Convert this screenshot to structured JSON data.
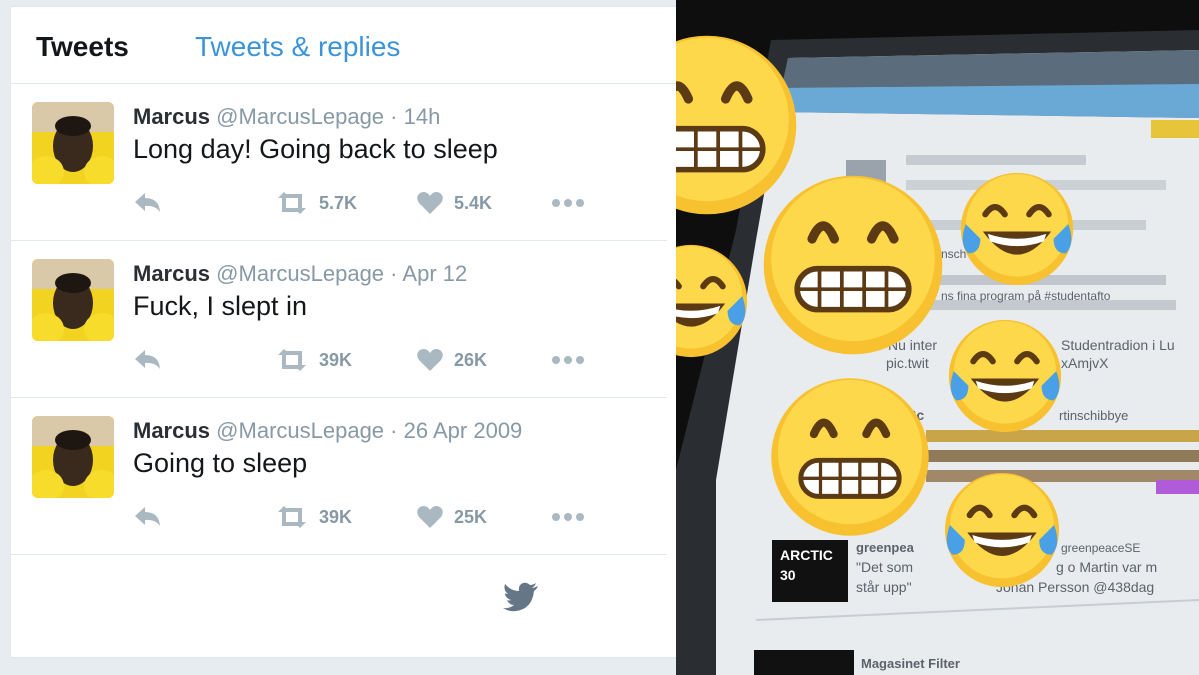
{
  "tabs": {
    "tweets": "Tweets",
    "replies": "Tweets & replies"
  },
  "tweets": [
    {
      "name": "Marcus",
      "handle": "@MarcusLepage",
      "separator": "·",
      "time": "14h",
      "text": "Long day! Going back to sleep",
      "retweets": "5.7K",
      "likes": "5.4K"
    },
    {
      "name": "Marcus",
      "handle": "@MarcusLepage",
      "separator": "·",
      "time": "Apr 12",
      "text": "Fuck, I slept in",
      "retweets": "39K",
      "likes": "26K"
    },
    {
      "name": "Marcus",
      "handle": "@MarcusLepage",
      "separator": "·",
      "time": "26 Apr 2009",
      "text": "Going to sleep",
      "retweets": "39K",
      "likes": "25K"
    }
  ],
  "icons": {
    "reply": "reply-icon",
    "retweet": "retweet-icon",
    "like": "heart-icon",
    "more": "more-icon",
    "footer": "twitter-bird-icon"
  },
  "colors": {
    "twitter_blue": "#1da1f2",
    "tab_link": "#3b94d9",
    "muted": "#8899a6",
    "footer_bird": "#657786"
  },
  "photo": {
    "screen_lines": [
      "Nu inter",
      "Studentradion i Lu",
      "pic.twit",
      "xAmjvX",
      "tin Sc",
      "rtinschibbye",
      "ARCTIC",
      "30",
      "greenpea",
      "greenpeaceSE",
      "\"Det som",
      "g o Martin var m",
      "står upp\"",
      "Johan Persson @438dag",
      "nsch  Johan Persson",
      "ns fina program på #studentafto",
      "Magasinet Filter"
    ],
    "emoji": [
      {
        "name": "grinning-face-emoji"
      },
      {
        "name": "grinning-face-emoji"
      },
      {
        "name": "grinning-face-emoji"
      },
      {
        "name": "tears-of-joy-emoji"
      },
      {
        "name": "tears-of-joy-emoji"
      },
      {
        "name": "tears-of-joy-emoji"
      },
      {
        "name": "tears-of-joy-emoji"
      }
    ]
  }
}
